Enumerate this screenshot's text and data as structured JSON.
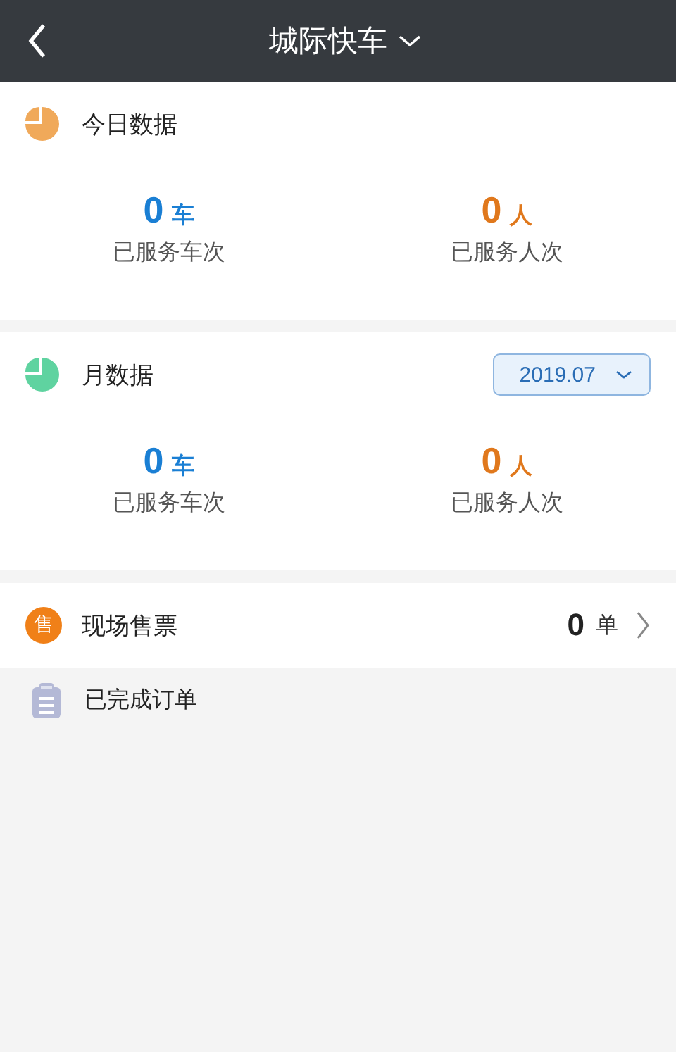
{
  "header": {
    "title": "城际快车"
  },
  "sections": [
    {
      "title": "今日数据",
      "color": "#f0a95a",
      "stats": [
        {
          "value": "0",
          "unit": "车",
          "label": "已服务车次",
          "color": "#1a7fd4"
        },
        {
          "value": "0",
          "unit": "人",
          "label": "已服务人次",
          "color": "#e0781c"
        }
      ]
    },
    {
      "title": "月数据",
      "color": "#5fd3a0",
      "date_picker": "2019.07",
      "stats": [
        {
          "value": "0",
          "unit": "车",
          "label": "已服务车次",
          "color": "#1a7fd4"
        },
        {
          "value": "0",
          "unit": "人",
          "label": "已服务人次",
          "color": "#e0781c"
        }
      ]
    }
  ],
  "ticket_row": {
    "badge": "售",
    "label": "现场售票",
    "count": "0",
    "unit": "单"
  },
  "completed": {
    "label": "已完成订单"
  }
}
